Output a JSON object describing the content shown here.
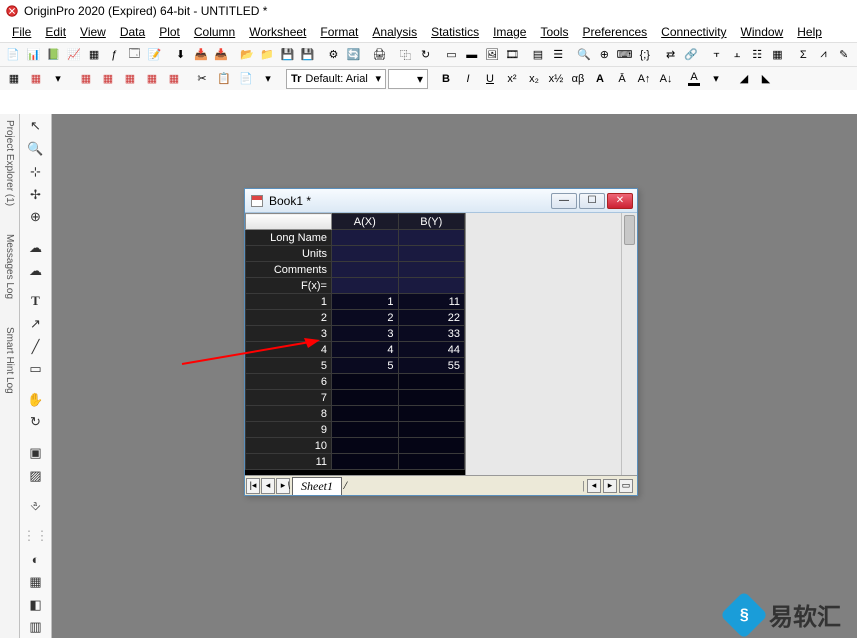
{
  "title": "OriginPro 2020 (Expired) 64-bit - UNTITLED *",
  "menu": {
    "file": "File",
    "edit": "Edit",
    "view": "View",
    "data": "Data",
    "plot": "Plot",
    "column": "Column",
    "worksheet": "Worksheet",
    "format": "Format",
    "analysis": "Analysis",
    "statistics": "Statistics",
    "image": "Image",
    "tools": "Tools",
    "preferences": "Preferences",
    "connectivity": "Connectivity",
    "window": "Window",
    "help": "Help"
  },
  "font": {
    "prefix": "Tr",
    "name": "Default: Arial",
    "size": ""
  },
  "side": {
    "project_explorer": "Project Explorer (1)",
    "messages": "Messages Log",
    "smart_hint": "Smart Hint Log"
  },
  "workbook": {
    "title": "Book1 *",
    "columns": {
      "a": "A(X)",
      "b": "B(Y)"
    },
    "labels": {
      "long_name": "Long Name",
      "units": "Units",
      "comments": "Comments",
      "fx": "F(x)="
    },
    "rows": [
      {
        "n": "1",
        "a": "1",
        "b": "11"
      },
      {
        "n": "2",
        "a": "2",
        "b": "22"
      },
      {
        "n": "3",
        "a": "3",
        "b": "33"
      },
      {
        "n": "4",
        "a": "4",
        "b": "44"
      },
      {
        "n": "5",
        "a": "5",
        "b": "55"
      },
      {
        "n": "6",
        "a": "",
        "b": ""
      },
      {
        "n": "7",
        "a": "",
        "b": ""
      },
      {
        "n": "8",
        "a": "",
        "b": ""
      },
      {
        "n": "9",
        "a": "",
        "b": ""
      },
      {
        "n": "10",
        "a": "",
        "b": ""
      },
      {
        "n": "11",
        "a": "",
        "b": ""
      }
    ],
    "tab": "Sheet1"
  },
  "watermark": "易软汇"
}
